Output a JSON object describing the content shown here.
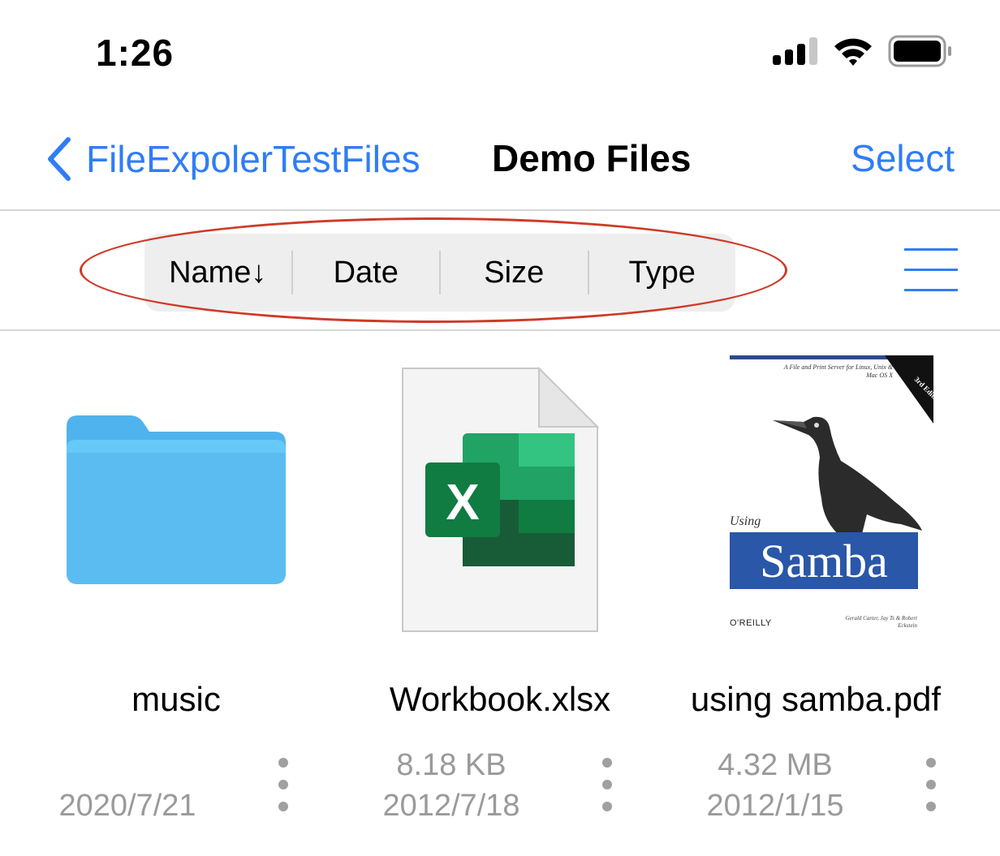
{
  "status_bar": {
    "time": "1:26"
  },
  "nav": {
    "back_label": "FileExpolerTestFiles",
    "title": "Demo Files",
    "select_label": "Select"
  },
  "sort": {
    "segments": [
      {
        "label": "Name↓"
      },
      {
        "label": "Date"
      },
      {
        "label": "Size"
      },
      {
        "label": "Type"
      }
    ]
  },
  "files": [
    {
      "name": "music",
      "size": "",
      "date": "2020/7/21",
      "icon": "folder-icon"
    },
    {
      "name": "Workbook.xlsx",
      "size": "8.18 KB",
      "date": "2012/7/18",
      "icon": "excel-document-icon"
    },
    {
      "name": "using samba.pdf",
      "size": "4.32 MB",
      "date": "2012/1/15",
      "icon": "pdf-thumbnail",
      "cover": {
        "tagline": "A File and Print Server for Linux, Unix & Mac OS X",
        "edition": "3rd Edition",
        "using": "Using",
        "title": "Samba",
        "publisher": "O'REILLY",
        "authors": "Gerald Carter, Jay Ts & Robert Eckstein"
      }
    }
  ],
  "colors": {
    "accent": "#2f7df6",
    "highlight": "#cf3a28",
    "folder": "#5bbcf2",
    "excel": "#1e7145"
  }
}
